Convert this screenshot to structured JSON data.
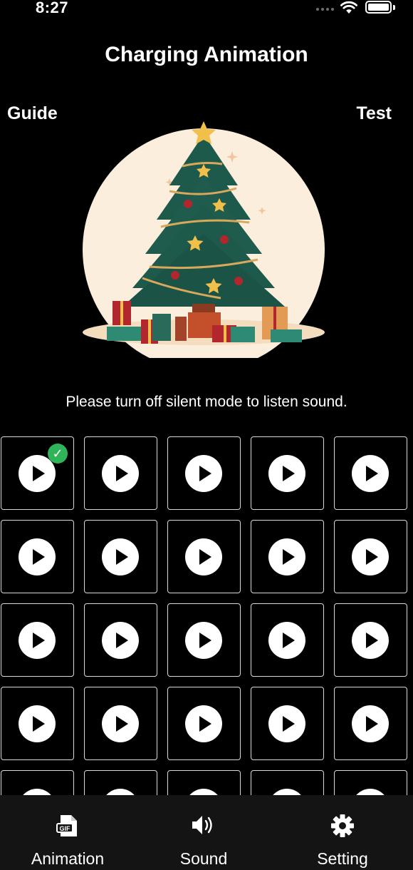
{
  "status_bar": {
    "time": "8:27"
  },
  "header": {
    "title": "Charging Animation",
    "guide_label": "Guide",
    "test_label": "Test"
  },
  "preview": {
    "icon": "christmas-tree-illustration"
  },
  "notice": "Please turn off silent mode to listen sound.",
  "grid": {
    "columns": 5,
    "visible_rows": 5,
    "item_count": 25,
    "selected_index": 0,
    "item_icon": "play-icon",
    "selected_icon": "checkmark-icon"
  },
  "tabbar": {
    "tabs": [
      {
        "label": "Animation",
        "icon": "gif-file-icon"
      },
      {
        "label": "Sound",
        "icon": "speaker-icon"
      },
      {
        "label": "Setting",
        "icon": "gear-icon"
      }
    ]
  },
  "colors": {
    "background": "#000000",
    "accent_check": "#2fb45a",
    "tree": "#1e5a4c",
    "circle": "#fbeedd",
    "star": "#f1c04a"
  }
}
